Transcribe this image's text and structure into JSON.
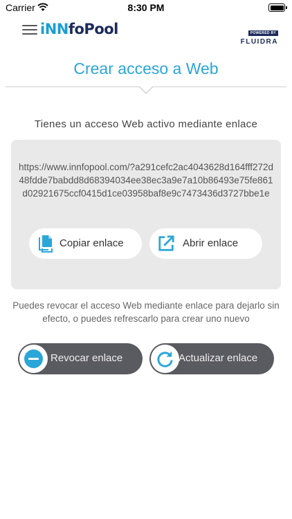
{
  "status_bar": {
    "carrier": "Carrier",
    "time": "8:30 PM"
  },
  "header": {
    "logo_part1": "iNN",
    "logo_part2": "foPool",
    "powered_by": "POWERED BY",
    "brand": "FLUIDRA"
  },
  "page": {
    "title": "Crear acceso a Web",
    "intro": "Tienes un acceso Web activo mediante enlace"
  },
  "link_box": {
    "url": "https://www.innfopool.com/?a291cefc2ac4043628d164fff272d48fdde7babdd8d68394034ee38ec3a9e7a10b86493e75fe861d02921675ccf0415d1ce03958baf8e9c7473436d3727bbe1e",
    "copy_label": "Copiar enlace",
    "open_label": "Abrir enlace"
  },
  "note": "Puedes revocar el acceso Web mediante enlace para dejarlo sin efecto, o puedes refrescarlo para crear uno nuevo",
  "actions": {
    "revoke_label": "Revocar enlace",
    "refresh_label": "Actualizar enlace"
  },
  "colors": {
    "accent": "#2aa6d9",
    "brand_dark": "#1c2b5a",
    "dark_button": "#5a5a61"
  }
}
